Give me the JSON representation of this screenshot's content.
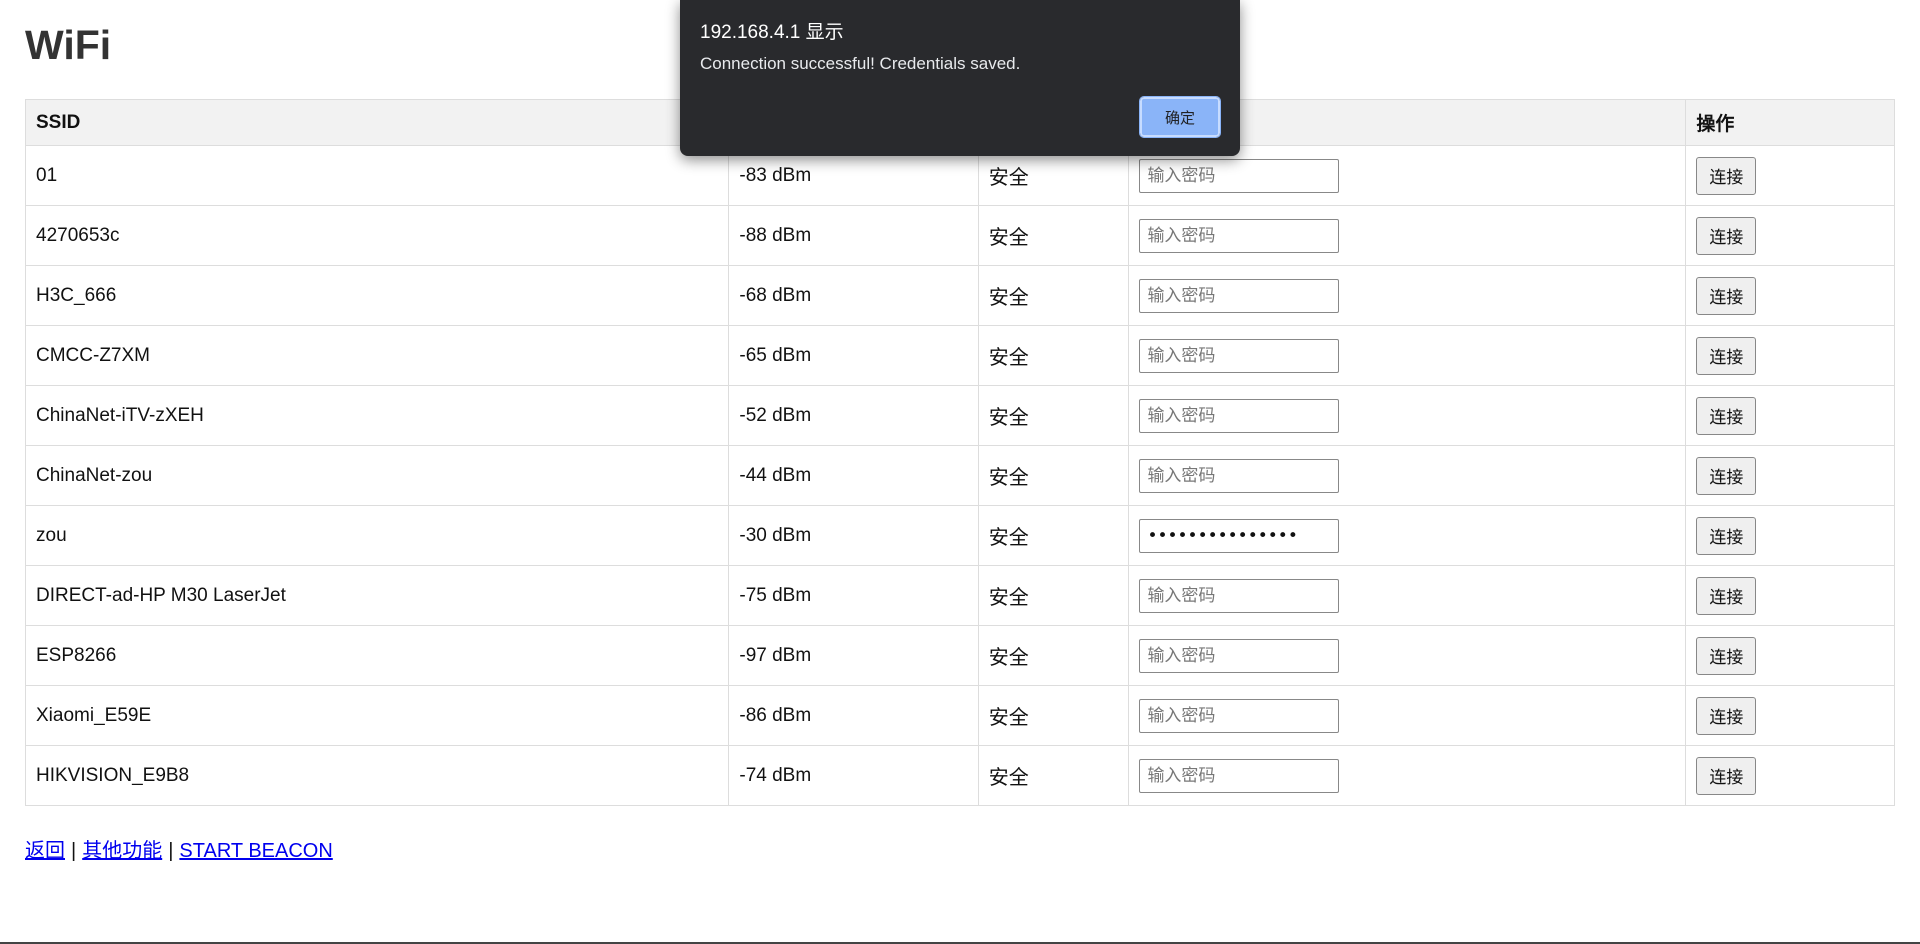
{
  "page": {
    "title": "WiFi"
  },
  "table": {
    "headers": {
      "ssid": "SSID",
      "operation": "操作"
    },
    "password_placeholder": "输入密码",
    "connect_label": "连接",
    "rows": [
      {
        "ssid": "01",
        "signal": "-83 dBm",
        "security": "安全",
        "password": ""
      },
      {
        "ssid": "4270653c",
        "signal": "-88 dBm",
        "security": "安全",
        "password": ""
      },
      {
        "ssid": "H3C_666",
        "signal": "-68 dBm",
        "security": "安全",
        "password": ""
      },
      {
        "ssid": "CMCC-Z7XM",
        "signal": "-65 dBm",
        "security": "安全",
        "password": ""
      },
      {
        "ssid": "ChinaNet-iTV-zXEH",
        "signal": "-52 dBm",
        "security": "安全",
        "password": ""
      },
      {
        "ssid": "ChinaNet-zou",
        "signal": "-44 dBm",
        "security": "安全",
        "password": ""
      },
      {
        "ssid": "zou",
        "signal": "-30 dBm",
        "security": "安全",
        "password": "•••••••••••••••"
      },
      {
        "ssid": "DIRECT-ad-HP M30 LaserJet",
        "signal": "-75 dBm",
        "security": "安全",
        "password": ""
      },
      {
        "ssid": "ESP8266",
        "signal": "-97 dBm",
        "security": "安全",
        "password": ""
      },
      {
        "ssid": "Xiaomi_E59E",
        "signal": "-86 dBm",
        "security": "安全",
        "password": ""
      },
      {
        "ssid": "HIKVISION_E9B8",
        "signal": "-74 dBm",
        "security": "安全",
        "password": ""
      }
    ]
  },
  "footer": {
    "back": "返回",
    "separator": "|",
    "other_functions": "其他功能",
    "start_beacon": "START BEACON"
  },
  "dialog": {
    "title": "192.168.4.1 显示",
    "message": "Connection successful! Credentials saved.",
    "ok_label": "确定"
  },
  "colors": {
    "security_text": "#f5a623",
    "dialog_bg": "#292a2d",
    "dialog_button": "#8ab4f8",
    "link": "#0000ee"
  }
}
